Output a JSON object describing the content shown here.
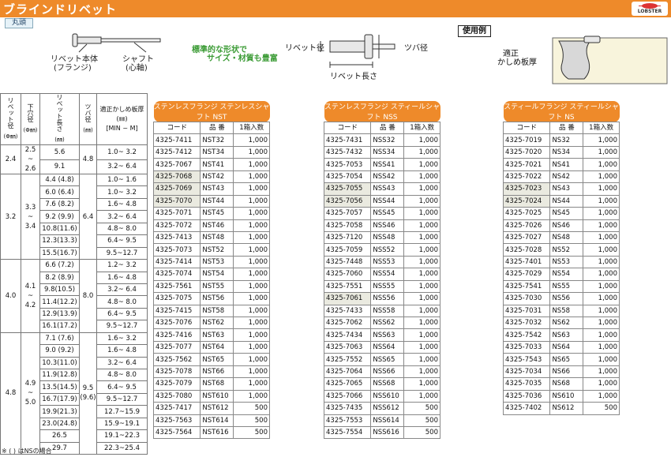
{
  "header": {
    "title": "ブラインドリベット",
    "brand": "LOBSTER"
  },
  "tab": "丸頭",
  "diagram": {
    "body": "リベット本体",
    "flange": "(フランジ)",
    "shaft": "シャフト",
    "mandrel": "(心軸)",
    "std1": "標準的な形状で",
    "std2": "サイズ・材質も豊富",
    "rivet_dia": "リベット径",
    "flange_dia": "ツバ径",
    "rivet_len": "リベット長さ",
    "use_example": "使用例",
    "grip1": "適正",
    "grip2": "かしめ板厚"
  },
  "left_head": {
    "rivet_dia": "リベット径",
    "rivet_dia_u": "(Φ㎜)",
    "hole": "下穴径",
    "hole_u": "(Φ㎜)",
    "length": "リベット長さ",
    "length_u": "(㎜)",
    "flange": "ツバ径",
    "flange_u": "(㎜)",
    "grip": "適正かしめ板厚",
    "grip_u": "(㎜)",
    "grip_mm": "[MIN ~ M]"
  },
  "left_rows": [
    {
      "len": "5.6",
      "grip": "1.0~ 3.2"
    },
    {
      "len": "9.1",
      "grip": "3.2~ 6.4"
    },
    {
      "len": "4.4 (4.8)",
      "grip": "1.0~ 1.6"
    },
    {
      "len": "6.0 (6.4)",
      "grip": "1.0~ 3.2"
    },
    {
      "len": "7.6 (8.2)",
      "grip": "1.6~ 4.8"
    },
    {
      "len": "9.2 (9.9)",
      "grip": "3.2~ 6.4"
    },
    {
      "len": "10.8(11.6)",
      "grip": "4.8~ 8.0"
    },
    {
      "len": "12.3(13.3)",
      "grip": "6.4~ 9.5"
    },
    {
      "len": "15.5(16.7)",
      "grip": "9.5~12.7"
    },
    {
      "len": "6.6 (7.2)",
      "grip": "1.2~ 3.2"
    },
    {
      "len": "8.2 (8.9)",
      "grip": "1.6~ 4.8"
    },
    {
      "len": "9.8(10.5)",
      "grip": "3.2~ 6.4"
    },
    {
      "len": "11.4(12.2)",
      "grip": "4.8~ 8.0"
    },
    {
      "len": "12.9(13.9)",
      "grip": "6.4~ 9.5"
    },
    {
      "len": "16.1(17.2)",
      "grip": "9.5~12.7"
    },
    {
      "len": "7.1 (7.6)",
      "grip": "1.6~ 3.2"
    },
    {
      "len": "9.0 (9.2)",
      "grip": "1.6~ 4.8"
    },
    {
      "len": "10.3(11.0)",
      "grip": "3.2~ 6.4"
    },
    {
      "len": "11.9(12.8)",
      "grip": "4.8~ 8.0"
    },
    {
      "len": "13.5(14.5)",
      "grip": "6.4~ 9.5"
    },
    {
      "len": "16.7(17.9)",
      "grip": "9.5~12.7"
    },
    {
      "len": "19.9(21.3)",
      "grip": "12.7~15.9"
    },
    {
      "len": "23.0(24.8)",
      "grip": "15.9~19.1"
    },
    {
      "len": "26.5",
      "grip": "19.1~22.3"
    },
    {
      "len": "29.7",
      "grip": "22.3~25.4"
    }
  ],
  "groups": [
    {
      "dia": "2.4",
      "hole": "2.5 ~ 2.6",
      "flange": "4.8"
    },
    {
      "dia": "3.2",
      "hole": "3.3 ~ 3.4",
      "flange": "6.4"
    },
    {
      "dia": "4.0",
      "hole": "4.1 ~ 4.2",
      "flange": "8.0"
    },
    {
      "dia": "4.8",
      "hole": "4.9 ~ 5.0",
      "flange": "9.5 (9.6)"
    }
  ],
  "col_head": {
    "code": "コード",
    "part": "品 番",
    "qty": "1箱入数"
  },
  "tables": [
    {
      "title": "ステンレスフランジ ステンレスシャフト NST",
      "rows": [
        [
          "4325-7411",
          "NST32",
          "1,000"
        ],
        [
          "4325-7412",
          "NST34",
          "1,000"
        ],
        [
          "4325-7067",
          "NST41",
          "1,000"
        ],
        [
          "4325-7068",
          "NST42",
          "1,000"
        ],
        [
          "4325-7069",
          "NST43",
          "1,000"
        ],
        [
          "4325-7070",
          "NST44",
          "1,000"
        ],
        [
          "4325-7071",
          "NST45",
          "1,000"
        ],
        [
          "4325-7072",
          "NST46",
          "1,000"
        ],
        [
          "4325-7413",
          "NST48",
          "1,000"
        ],
        [
          "4325-7073",
          "NST52",
          "1,000"
        ],
        [
          "4325-7414",
          "NST53",
          "1,000"
        ],
        [
          "4325-7074",
          "NST54",
          "1,000"
        ],
        [
          "4325-7561",
          "NST55",
          "1,000"
        ],
        [
          "4325-7075",
          "NST56",
          "1,000"
        ],
        [
          "4325-7415",
          "NST58",
          "1,000"
        ],
        [
          "4325-7076",
          "NST62",
          "1,000"
        ],
        [
          "4325-7416",
          "NST63",
          "1,000"
        ],
        [
          "4325-7077",
          "NST64",
          "1,000"
        ],
        [
          "4325-7562",
          "NST65",
          "1,000"
        ],
        [
          "4325-7078",
          "NST66",
          "1,000"
        ],
        [
          "4325-7079",
          "NST68",
          "1,000"
        ],
        [
          "4325-7080",
          "NST610",
          "1,000"
        ],
        [
          "4325-7417",
          "NST612",
          "500"
        ],
        [
          "4325-7563",
          "NST614",
          "500"
        ],
        [
          "4325-7564",
          "NST616",
          "500"
        ]
      ]
    },
    {
      "title": "ステンレスフランジ スティールシャフト NSS",
      "rows": [
        [
          "4325-7431",
          "NSS32",
          "1,000"
        ],
        [
          "4325-7432",
          "NSS34",
          "1,000"
        ],
        [
          "4325-7053",
          "NSS41",
          "1,000"
        ],
        [
          "4325-7054",
          "NSS42",
          "1,000"
        ],
        [
          "4325-7055",
          "NSS43",
          "1,000"
        ],
        [
          "4325-7056",
          "NSS44",
          "1,000"
        ],
        [
          "4325-7057",
          "NSS45",
          "1,000"
        ],
        [
          "4325-7058",
          "NSS46",
          "1,000"
        ],
        [
          "4325-7120",
          "NSS48",
          "1,000"
        ],
        [
          "4325-7059",
          "NSS52",
          "1,000"
        ],
        [
          "4325-7448",
          "NSS53",
          "1,000"
        ],
        [
          "4325-7060",
          "NSS54",
          "1,000"
        ],
        [
          "4325-7551",
          "NSS55",
          "1,000"
        ],
        [
          "4325-7061",
          "NSS56",
          "1,000"
        ],
        [
          "4325-7433",
          "NSS58",
          "1,000"
        ],
        [
          "4325-7062",
          "NSS62",
          "1,000"
        ],
        [
          "4325-7434",
          "NSS63",
          "1,000"
        ],
        [
          "4325-7063",
          "NSS64",
          "1,000"
        ],
        [
          "4325-7552",
          "NSS65",
          "1,000"
        ],
        [
          "4325-7064",
          "NSS66",
          "1,000"
        ],
        [
          "4325-7065",
          "NSS68",
          "1,000"
        ],
        [
          "4325-7066",
          "NSS610",
          "1,000"
        ],
        [
          "4325-7435",
          "NSS612",
          "500"
        ],
        [
          "4325-7553",
          "NSS614",
          "500"
        ],
        [
          "4325-7554",
          "NSS616",
          "500"
        ]
      ]
    },
    {
      "title": "スティールフランジ スティールシャフト NS",
      "rows": [
        [
          "4325-7019",
          "NS32",
          "1,000"
        ],
        [
          "4325-7020",
          "NS34",
          "1,000"
        ],
        [
          "4325-7021",
          "NS41",
          "1,000"
        ],
        [
          "4325-7022",
          "NS42",
          "1,000"
        ],
        [
          "4325-7023",
          "NS43",
          "1,000"
        ],
        [
          "4325-7024",
          "NS44",
          "1,000"
        ],
        [
          "4325-7025",
          "NS45",
          "1,000"
        ],
        [
          "4325-7026",
          "NS46",
          "1,000"
        ],
        [
          "4325-7027",
          "NS48",
          "1,000"
        ],
        [
          "4325-7028",
          "NS52",
          "1,000"
        ],
        [
          "4325-7401",
          "NS53",
          "1,000"
        ],
        [
          "4325-7029",
          "NS54",
          "1,000"
        ],
        [
          "4325-7541",
          "NS55",
          "1,000"
        ],
        [
          "4325-7030",
          "NS56",
          "1,000"
        ],
        [
          "4325-7031",
          "NS58",
          "1,000"
        ],
        [
          "4325-7032",
          "NS62",
          "1,000"
        ],
        [
          "4325-7542",
          "NS63",
          "1,000"
        ],
        [
          "4325-7033",
          "NS64",
          "1,000"
        ],
        [
          "4325-7543",
          "NS65",
          "1,000"
        ],
        [
          "4325-7034",
          "NS66",
          "1,000"
        ],
        [
          "4325-7035",
          "NS68",
          "1,000"
        ],
        [
          "4325-7036",
          "NS610",
          "1,000"
        ],
        [
          "4325-7402",
          "NS612",
          "500"
        ]
      ]
    }
  ],
  "highlight": [
    [
      3,
      4,
      5
    ],
    [
      4,
      5,
      13
    ],
    [
      4,
      5
    ]
  ],
  "footnote": "※ ( ) はNSの場合",
  "colors": {
    "accent": "#ee8a2a",
    "green": "#3b9b35"
  }
}
